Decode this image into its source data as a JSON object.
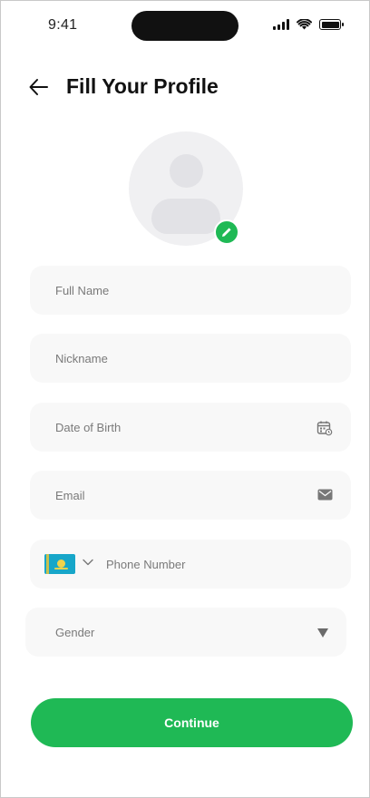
{
  "status_bar": {
    "time": "9:41",
    "icons": [
      "signal-icon",
      "wifi-icon",
      "battery-icon"
    ]
  },
  "header": {
    "back_icon": "arrow-left-icon",
    "title": "Fill Your Profile"
  },
  "avatar": {
    "placeholder_icon": "user-silhouette-icon",
    "edit_icon": "pencil-icon"
  },
  "form": {
    "full_name_placeholder": "Full Name",
    "nickname_placeholder": "Nickname",
    "dob_placeholder": "Date of Birth",
    "dob_icon": "calendar-icon",
    "email_placeholder": "Email",
    "email_icon": "mail-icon",
    "phone_placeholder": "Phone Number",
    "phone_flag_icon": "kazakhstan-flag-icon",
    "phone_dropdown_icon": "chevron-down-icon",
    "gender_placeholder": "Gender",
    "gender_dropdown_icon": "triangle-down-icon"
  },
  "actions": {
    "continue_label": "Continue"
  },
  "colors": {
    "accent": "#1fb955",
    "field_bg": "#f8f8f8",
    "placeholder_text": "#7a7a7a"
  }
}
